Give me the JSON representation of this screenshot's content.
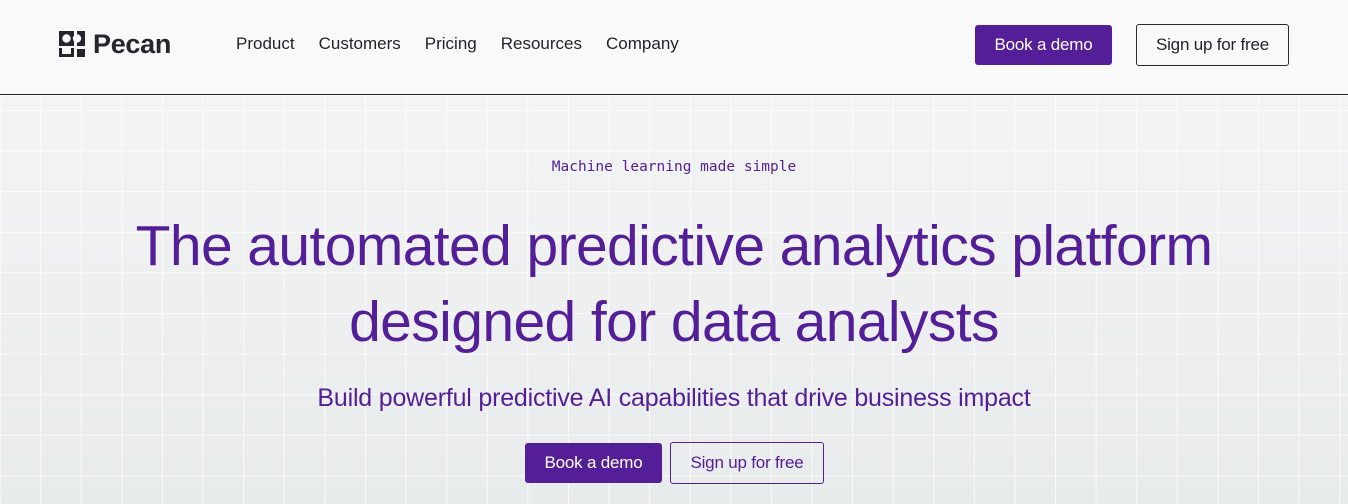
{
  "brand": {
    "name": "Pecan",
    "logo_icon": "pecan-logo-mark",
    "accent_color": "#531e97"
  },
  "nav": {
    "items": [
      {
        "label": "Product"
      },
      {
        "label": "Customers"
      },
      {
        "label": "Pricing"
      },
      {
        "label": "Resources"
      },
      {
        "label": "Company"
      }
    ]
  },
  "header_actions": {
    "book_demo": "Book a demo",
    "sign_up": "Sign up for free"
  },
  "hero": {
    "tagline": "Machine learning made simple",
    "headline_line1": "The automated predictive analytics platform",
    "headline_line2": "designed for data analysts",
    "subheadline": "Build powerful predictive AI capabilities that drive business impact",
    "book_demo": "Book a demo",
    "sign_up": "Sign up for free"
  }
}
